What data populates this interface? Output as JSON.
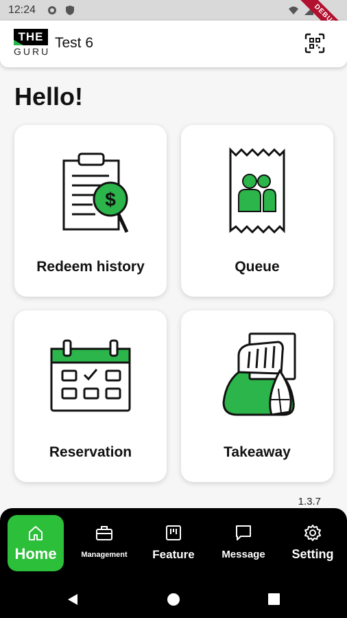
{
  "status_bar": {
    "time": "12:24",
    "debug_banner": "DEBUG"
  },
  "app_bar": {
    "logo_top": "THE",
    "logo_bottom": "GURU",
    "title": "Test 6"
  },
  "greeting": "Hello!",
  "cards": [
    {
      "label": "Redeem history",
      "icon": "clipboard-dollar-icon"
    },
    {
      "label": "Queue",
      "icon": "queue-ticket-icon"
    },
    {
      "label": "Reservation",
      "icon": "calendar-icon"
    },
    {
      "label": "Takeaway",
      "icon": "takeaway-bag-icon"
    }
  ],
  "version": "1.3.7",
  "bottom_nav": [
    {
      "label": "Home",
      "icon": "home-icon",
      "active": true
    },
    {
      "label": "Management",
      "icon": "briefcase-icon",
      "active": false
    },
    {
      "label": "Feature",
      "icon": "feature-icon",
      "active": false
    },
    {
      "label": "Message",
      "icon": "message-icon",
      "active": false
    },
    {
      "label": "Setting",
      "icon": "gear-icon",
      "active": false
    }
  ],
  "colors": {
    "accent": "#2cb54a",
    "nav_active": "#2cbf3a",
    "nav_bg": "#000000",
    "background": "#f6f6f6"
  }
}
